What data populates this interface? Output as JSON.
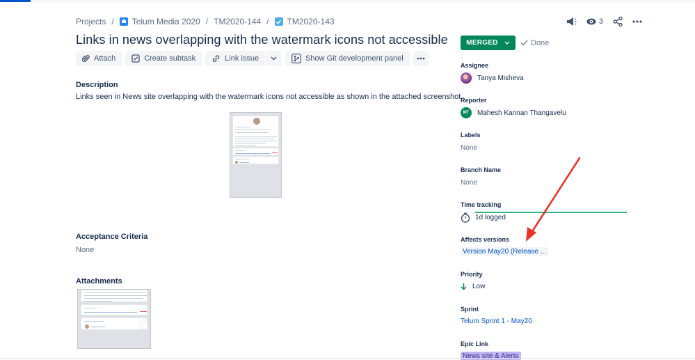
{
  "breadcrumb": {
    "items": [
      {
        "label": "Projects"
      },
      {
        "label": "Telum Media 2020"
      },
      {
        "label": "TM2020-144"
      },
      {
        "label": "TM2020-143"
      }
    ],
    "separator": "/"
  },
  "top_actions": {
    "watchers_count": "3"
  },
  "issue": {
    "title": "Links in news overlapping with the watermark icons not accessible"
  },
  "toolbar": {
    "attach": "Attach",
    "create_subtask": "Create subtask",
    "link_issue": "Link issue",
    "git_panel": "Show Git development panel"
  },
  "description": {
    "label": "Description",
    "text": "Links seen in News site overlapping with the watermark icons not accessible as shown in the attached screenshot."
  },
  "acceptance": {
    "label": "Acceptance Criteria",
    "value": "None"
  },
  "attachments": {
    "label": "Attachments"
  },
  "status": {
    "label": "MERGED",
    "resolution": "Done"
  },
  "fields": {
    "assignee": {
      "label": "Assignee",
      "value": "Tanya Misheva"
    },
    "reporter": {
      "label": "Reporter",
      "value": "Mahesh Kannan Thangavelu",
      "initials": "MT"
    },
    "labels": {
      "label": "Labels",
      "value": "None"
    },
    "branch": {
      "label": "Branch Name",
      "value": "None"
    },
    "time_tracking": {
      "label": "Time tracking",
      "value": "1d logged"
    },
    "affects_versions": {
      "label": "Affects versions",
      "value": "Version May20 (Release ..."
    },
    "priority": {
      "label": "Priority",
      "value": "Low"
    },
    "sprint": {
      "label": "Sprint",
      "value": "Telum Sprint 1 - May20"
    },
    "epic_link": {
      "label": "Epic Link",
      "value": "News site & Alerts"
    }
  },
  "colors": {
    "status_green": "#00875a",
    "link_blue": "#0052cc",
    "epic_purple": "#c0b6f2",
    "annotation_red": "#e8342a",
    "time_bar_green": "#36b37e"
  },
  "icons": {
    "attach": "paperclip-icon",
    "subtask": "subtask-icon",
    "link": "link-icon",
    "git": "git-panel-icon",
    "feedback": "megaphone-icon",
    "watch": "eye-icon",
    "share": "share-icon",
    "more": "more-icon",
    "priority": "arrow-down-icon",
    "time": "stopwatch-icon"
  }
}
